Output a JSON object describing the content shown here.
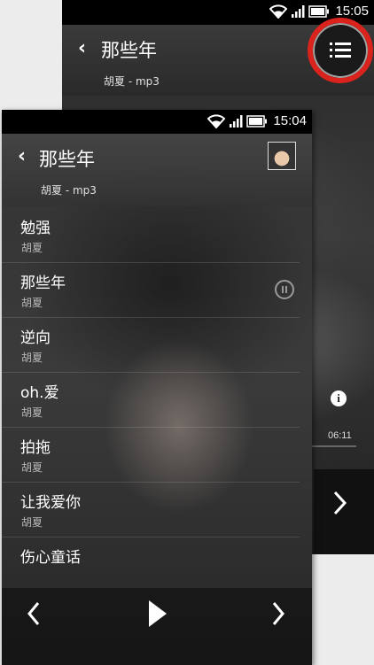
{
  "back_screen": {
    "status": {
      "time": "15:05"
    },
    "header": {
      "title": "那些年",
      "subtitle": "胡夏 - mp3"
    },
    "duration": "06:11",
    "highlight_color": "#d9231c"
  },
  "front_screen": {
    "status": {
      "time": "15:04"
    },
    "header": {
      "title": "那些年",
      "subtitle": "胡夏 - mp3"
    },
    "playlist": [
      {
        "title": "勉强",
        "artist": "胡夏"
      },
      {
        "title": "那些年",
        "artist": "胡夏",
        "playing": true
      },
      {
        "title": "逆向",
        "artist": "胡夏"
      },
      {
        "title": "oh.爱",
        "artist": "胡夏"
      },
      {
        "title": "拍拖",
        "artist": "胡夏"
      },
      {
        "title": "让我爱你",
        "artist": "胡夏"
      },
      {
        "title": "伤心童话",
        "artist": ""
      }
    ]
  },
  "icons": [
    "wifi-icon",
    "signal-icon",
    "battery-icon",
    "back-icon",
    "playlist-icon",
    "pause-icon",
    "info-icon",
    "previous-icon",
    "play-icon",
    "next-icon"
  ]
}
